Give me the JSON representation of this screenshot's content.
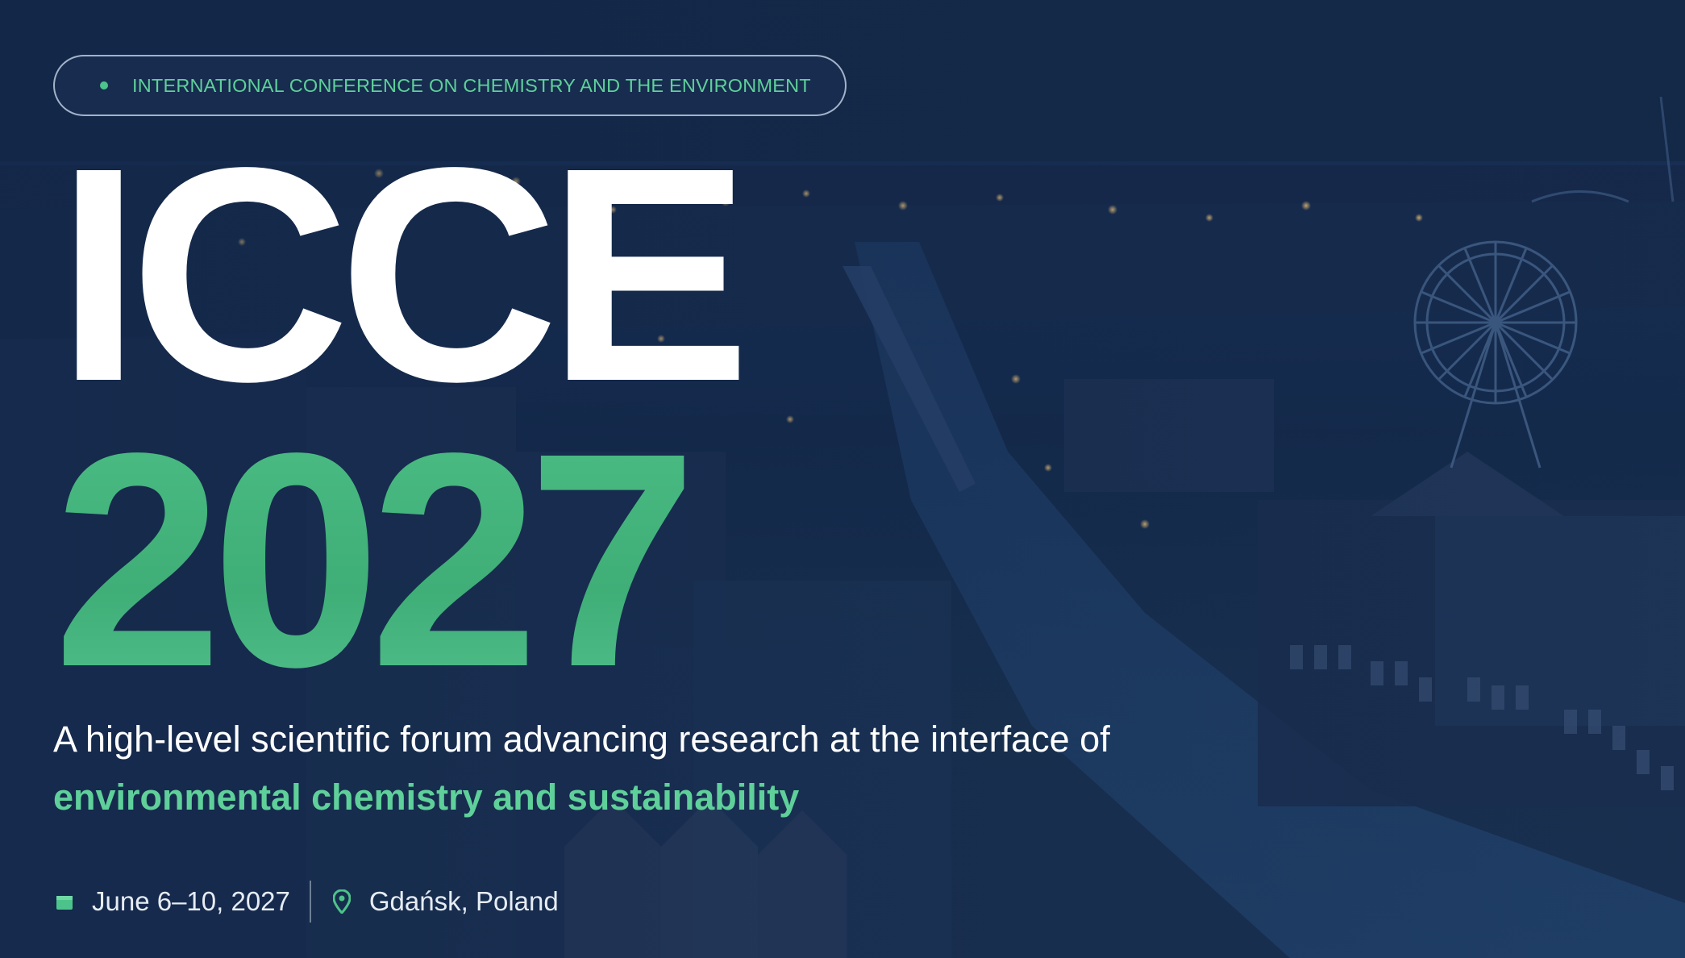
{
  "badge": {
    "label": "INTERNATIONAL CONFERENCE ON CHEMISTRY AND THE ENVIRONMENT"
  },
  "title": {
    "line1": "ICCE",
    "line2": "2027"
  },
  "tagline": {
    "text": "A high-level scientific forum advancing research at the interface of",
    "highlight": "environmental chemistry and sustainability"
  },
  "event": {
    "date": "June 6–10, 2027",
    "location": "Gdańsk, Poland",
    "date_icon": "calendar-icon",
    "location_icon": "map-pin-icon"
  },
  "colors": {
    "accent": "#44b87f",
    "background": "#152a4c",
    "text": "#ffffff"
  }
}
